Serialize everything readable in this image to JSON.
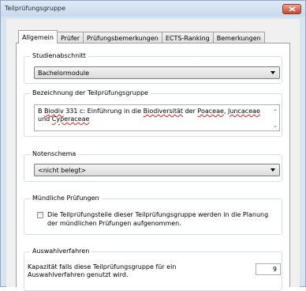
{
  "window": {
    "title": "Teilprüfungsgruppe"
  },
  "tabs": [
    {
      "label": "Allgemein",
      "active": true
    },
    {
      "label": "Prüfer",
      "active": false
    },
    {
      "label": "Prüfungsbemerkungen",
      "active": false
    },
    {
      "label": "ECTS-Ranking",
      "active": false
    },
    {
      "label": "Bemerkungen",
      "active": false
    }
  ],
  "studienabschnitt": {
    "label": "Studienabschnitt",
    "value": "Bachelormodule"
  },
  "bezeichnung": {
    "label": "Bezeichnung der Teilprüfungsgruppe",
    "parts": [
      "B ",
      "Biodiv",
      " 331 c: Einführung in die ",
      "Biodiversität",
      " der ",
      "Poaceae",
      ", ",
      "Juncaceae",
      " und ",
      "Cyperaceae"
    ]
  },
  "notenschema": {
    "label": "Notenschema",
    "value": "<nicht belegt>"
  },
  "muendlich": {
    "label": "Mündliche Prüfungen",
    "checkbox_text": "Die Teilprüfungsteile dieser Teilprüfungsgruppe werden in die Planung der mündlichen Prüfungen aufgenommen.",
    "checked": false
  },
  "auswahl": {
    "label": "Auswahlverfahren",
    "capacity_text": "Kapazität falls diese Teilprüfungsgruppe für ein Auswahlverfahren genutzt wird.",
    "capacity_value": "9"
  },
  "icons": {
    "close": "close-icon",
    "dropdown": "chevron-down-icon",
    "scroll_up": "scroll-up-icon",
    "scroll_down": "scroll-down-icon"
  },
  "colors": {
    "close_button": "#c7472f",
    "spell_underline": "#e02020"
  }
}
